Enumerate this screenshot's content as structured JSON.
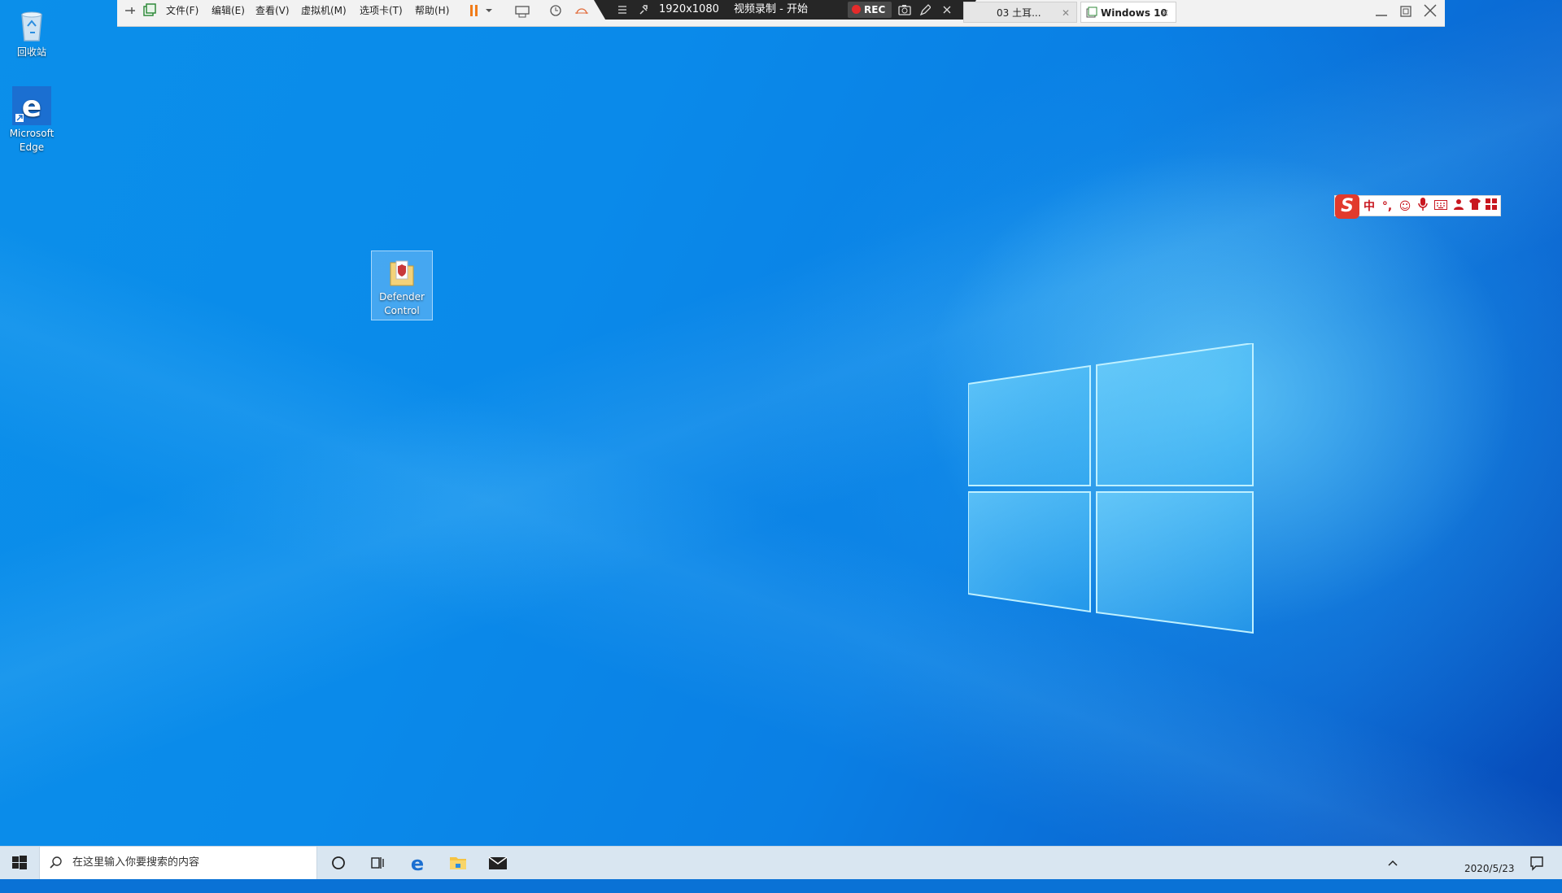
{
  "desktop": {
    "icons": [
      {
        "label": "回收站",
        "icon": "recycle-bin-icon"
      },
      {
        "label": "Microsoft Edge",
        "icon": "edge-icon"
      },
      {
        "label": "Defender Control",
        "icon": "defender-control-icon"
      }
    ]
  },
  "vm_toolbar": {
    "menus": [
      "文件(F)",
      "编辑(E)",
      "查看(V)",
      "虚拟机(M)",
      "选项卡(T)",
      "帮助(H)"
    ],
    "resolution": "1920x1080",
    "recording_status": "视频录制 - 开始",
    "rec_label": "REC",
    "tabs": [
      {
        "label": "03 土耳...",
        "active": false
      },
      {
        "label": "Windows 10",
        "active": true
      }
    ]
  },
  "ime_bar": {
    "logo": "S",
    "mode": "中",
    "punct": "°,"
  },
  "taskbar": {
    "search_placeholder": "在这里输入你要搜索的内容",
    "date": "2020/5/23"
  },
  "colors": {
    "wallpaper_blue": "#0a7fe4",
    "rec_red": "#e52b2b",
    "ime_red": "#c8171f",
    "taskbar": "#d9e6f1"
  }
}
